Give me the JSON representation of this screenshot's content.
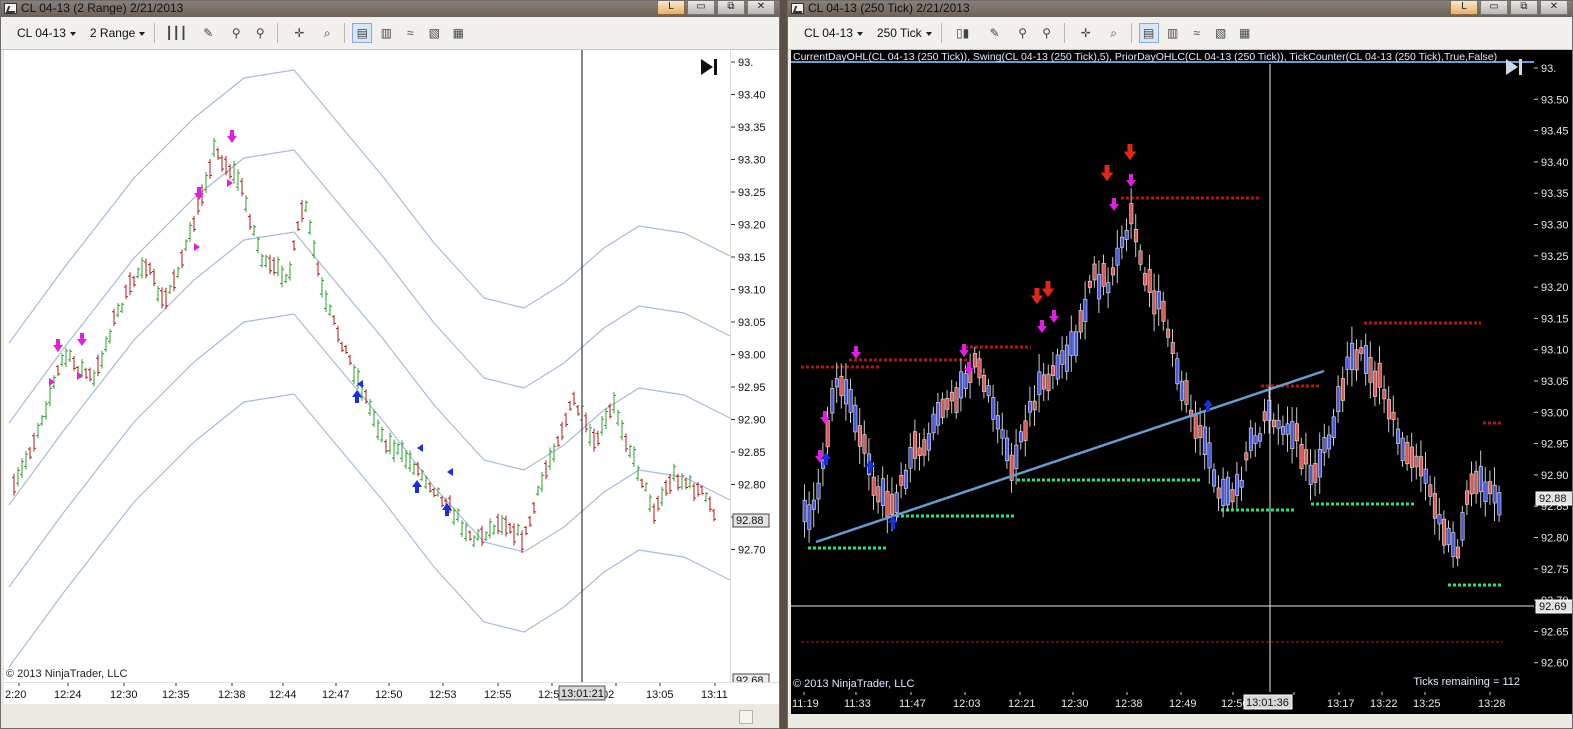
{
  "left": {
    "title": "CL 04-13 (2 Range)  2/21/2013",
    "toolbar": {
      "instrument": "CL 04-13",
      "period": "2 Range"
    },
    "copyright": "© 2013 NinjaTrader, LLC",
    "price_labels": [
      "93.",
      "93.40",
      "93.35",
      "93.30",
      "93.25",
      "93.20",
      "93.15",
      "93.10",
      "93.05",
      "93.00",
      "92.95",
      "92.90",
      "92.85",
      "92.80",
      "92.75",
      "92.70"
    ],
    "current_price": "92.88",
    "bottom_price": "92.68",
    "time_labels": [
      "2:20",
      "12:24",
      "12:30",
      "12:35",
      "12:38",
      "12:44",
      "12:47",
      "12:50",
      "12:53",
      "12:55",
      "12:5",
      "02",
      "13:05",
      "13:11"
    ],
    "crosshair_time": "13:01:21"
  },
  "right": {
    "title": "CL 04-13 (250 Tick)  2/21/2013",
    "toolbar": {
      "instrument": "CL 04-13",
      "period": "250 Tick"
    },
    "indicators": "CurrentDayOHL(CL 04-13 (250 Tick)), Swing(CL 04-13 (250 Tick),5), PriorDayOHLC(CL 04-13 (250 Tick)), TickCounter(CL 04-13 (250 Tick),True,False)",
    "copyright": "© 2013 NinjaTrader, LLC",
    "ticks_remaining": "Ticks remaining = 112",
    "price_labels": [
      "93.",
      "93.50",
      "93.45",
      "93.40",
      "93.35",
      "93.30",
      "93.25",
      "93.20",
      "93.15",
      "93.10",
      "93.05",
      "93.00",
      "92.95",
      "92.90",
      "92.85",
      "92.80",
      "92.75",
      "92.70",
      "92.65",
      "92.60"
    ],
    "current_price": "92.88",
    "crosshair_price": "92.69",
    "time_labels": [
      "11:19",
      "11:33",
      "11:47",
      "12:03",
      "12:21",
      "12:30",
      "12:38",
      "12:49",
      "12:56",
      "5",
      "13:17",
      "13:22",
      "13:25",
      "13:28"
    ],
    "crosshair_time": "13:01:36"
  },
  "colors": {
    "chart_left_bg": "#ffffff",
    "chart_right_bg": "#000000",
    "up_bar": "#2e9e2e",
    "down_bar": "#b01818",
    "up_candle": "#4a58d8",
    "down_candle": "#d85858",
    "keltner": "#a8bcd8",
    "swing_high": "#a81818",
    "swing_low": "#28e080",
    "trendline": "#6a9cd0",
    "arrow_magenta": "#e020e0",
    "arrow_blue": "#1830d8",
    "arrow_red": "#e02818"
  },
  "icons": [
    "chart-window-icon",
    "bar-type-icon",
    "draw-pencil-icon",
    "crosshair-icon",
    "zoom-icon",
    "data-box-icon",
    "properties-icon",
    "go-to-end-icon"
  ]
}
